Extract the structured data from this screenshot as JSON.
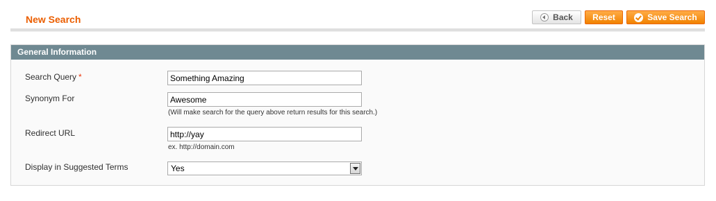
{
  "header": {
    "title": "New Search",
    "buttons": {
      "back": "Back",
      "reset": "Reset",
      "save": "Save Search"
    }
  },
  "section": {
    "title": "General Information"
  },
  "form": {
    "search_query": {
      "label": "Search Query",
      "required_mark": "*",
      "value": "Something Amazing"
    },
    "synonym_for": {
      "label": "Synonym For",
      "value": "Awesome",
      "note": "(Will make search for the query above return results for this search.)"
    },
    "redirect_url": {
      "label": "Redirect URL",
      "value": "http://yay",
      "note": "ex. http://domain.com"
    },
    "display_in_suggested": {
      "label": "Display in Suggested Terms",
      "selected": "Yes"
    }
  },
  "colors": {
    "accent": "#eb5e00",
    "button_orange": "#f18200",
    "section_header": "#6f8992"
  },
  "icons": {
    "back": "back-arrow-icon",
    "save": "checkmark-icon",
    "select": "chevron-down-icon"
  }
}
